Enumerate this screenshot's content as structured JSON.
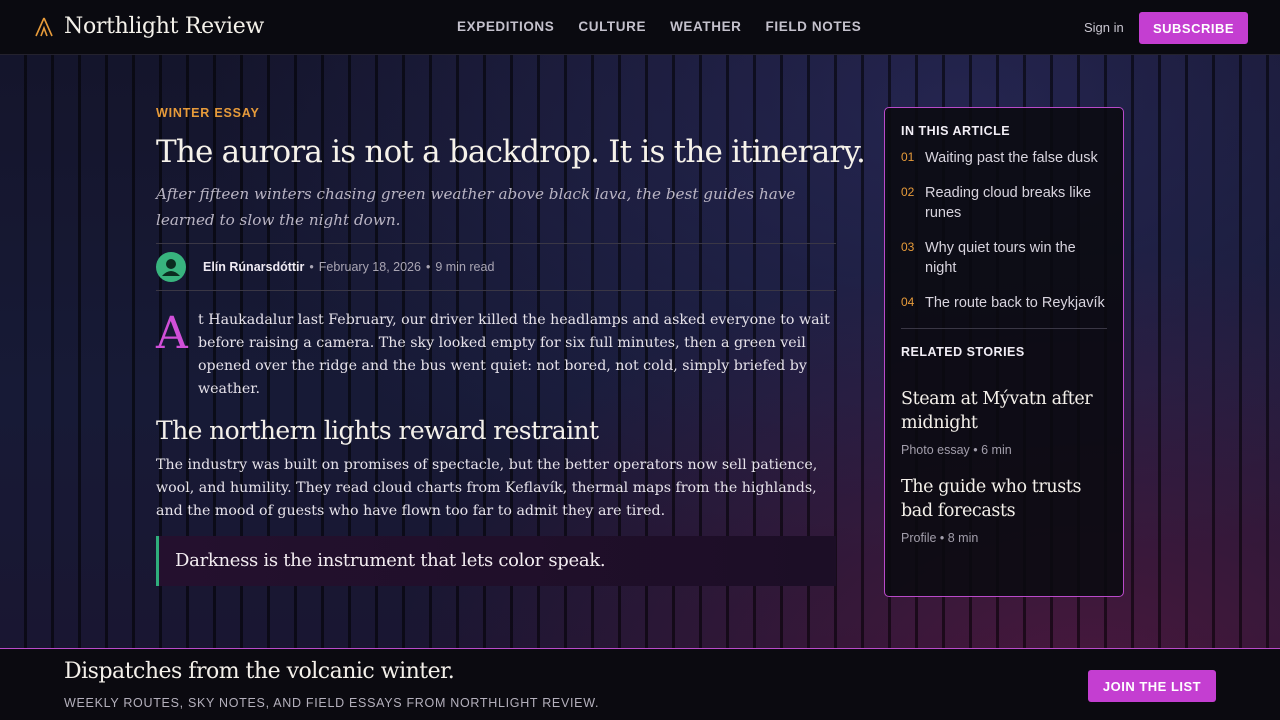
{
  "header": {
    "brand": "Northlight Review",
    "logo_icon": "tent-icon",
    "nav": [
      "EXPEDITIONS",
      "CULTURE",
      "WEATHER",
      "FIELD NOTES"
    ],
    "sign_in": "Sign in",
    "subscribe": "SUBSCRIBE"
  },
  "article": {
    "kicker": "WINTER ESSAY",
    "headline": "The aurora is not a backdrop. It is the itinerary.",
    "dek": "After fifteen winters chasing green weather above black lava, the best guides have learned to slow the night down.",
    "author": "Elín Rúnarsdóttir",
    "date": "February 18, 2026",
    "read_time": "9 min read",
    "dropcap": "A",
    "lead": "t Haukadalur last February, our driver killed the headlamps and asked everyone to wait before raising a camera. The sky looked empty for six full minutes, then a green veil opened over the ridge and the bus went quiet: not bored, not cold, simply briefed by weather.",
    "section_head": "The northern lights reward restraint",
    "body": "The industry was built on promises of spectacle, but the better operators now sell patience, wool, and humility. They read cloud charts from Keflavík, thermal maps from the highlands, and the mood of guests who have flown too far to admit they are tired.",
    "pullquote": "Darkness is the instrument that lets color speak."
  },
  "sidebar": {
    "toc_title": "IN THIS ARTICLE",
    "toc": [
      {
        "num": "01",
        "label": "Waiting past the false dusk"
      },
      {
        "num": "02",
        "label": "Reading cloud breaks like runes"
      },
      {
        "num": "03",
        "label": "Why quiet tours win the night"
      },
      {
        "num": "04",
        "label": "The route back to Reykjavík"
      }
    ],
    "related_title": "RELATED STORIES",
    "related": [
      {
        "title": "Steam at Mývatn after midnight",
        "meta": "Photo essay • 6 min"
      },
      {
        "title": "The guide who trusts bad forecasts",
        "meta": "Profile • 8 min"
      }
    ]
  },
  "footer": {
    "title": "Dispatches from the volcanic winter.",
    "subtitle": "WEEKLY ROUTES, SKY NOTES, AND FIELD ESSAYS FROM NORTHLIGHT REVIEW.",
    "cta": "JOIN THE LIST"
  },
  "colors": {
    "accent": "#c43ed1",
    "kicker": "#e79b3a",
    "avatar": "#38b47e",
    "quote_border": "#2fae7c"
  }
}
